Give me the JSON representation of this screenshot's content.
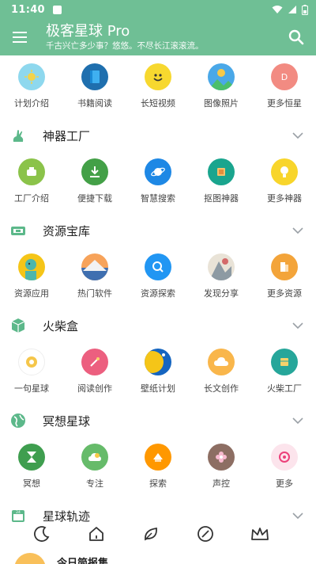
{
  "status": {
    "time": "11:40"
  },
  "header": {
    "title": "极客星球 Pro",
    "subtitle": "千古兴亡多少事？悠悠。不尽长江滚滚流。",
    "menu_icon": "hamburger-menu-icon",
    "search_icon": "search-icon"
  },
  "theme": {
    "primary": "#6fbf95"
  },
  "top_items": [
    {
      "label": "计划介绍",
      "icon": "sun-icon"
    },
    {
      "label": "书籍阅读",
      "icon": "book-icon"
    },
    {
      "label": "长短视频",
      "icon": "smiley-icon"
    },
    {
      "label": "图像照片",
      "icon": "picture-icon"
    },
    {
      "label": "更多恒星",
      "icon": "more-stars-icon"
    }
  ],
  "sections": [
    {
      "title": "神器工厂",
      "icon": "rabbit-icon",
      "items": [
        {
          "label": "工厂介绍",
          "icon": "factory-intro-icon"
        },
        {
          "label": "便捷下载",
          "icon": "download-icon"
        },
        {
          "label": "智慧搜索",
          "icon": "planet-icon"
        },
        {
          "label": "抠图神器",
          "icon": "cutout-icon"
        },
        {
          "label": "更多神器",
          "icon": "lightbulb-icon"
        }
      ]
    },
    {
      "title": "资源宝库",
      "icon": "treasure-icon",
      "items": [
        {
          "label": "资源应用",
          "icon": "app-avatar-icon"
        },
        {
          "label": "热门软件",
          "icon": "mountain-icon"
        },
        {
          "label": "资源探索",
          "icon": "explore-icon"
        },
        {
          "label": "发现分享",
          "icon": "share-illustration-icon"
        },
        {
          "label": "更多资源",
          "icon": "more-resources-icon"
        }
      ]
    },
    {
      "title": "火柴盒",
      "icon": "box-icon",
      "items": [
        {
          "label": "一句星球",
          "icon": "sentence-icon"
        },
        {
          "label": "阅读创作",
          "icon": "reading-icon"
        },
        {
          "label": "壁纸计划",
          "icon": "wallpaper-icon"
        },
        {
          "label": "长文创作",
          "icon": "cloud-icon"
        },
        {
          "label": "火柴工厂",
          "icon": "match-factory-icon"
        }
      ]
    },
    {
      "title": "冥想星球",
      "icon": "globe-icon",
      "items": [
        {
          "label": "冥想",
          "icon": "hourglass-icon"
        },
        {
          "label": "专注",
          "icon": "focus-icon"
        },
        {
          "label": "探索",
          "icon": "explore-orange-icon"
        },
        {
          "label": "声控",
          "icon": "flower-icon"
        },
        {
          "label": "更多",
          "icon": "more-pink-icon"
        }
      ]
    },
    {
      "title": "星球轨迹",
      "icon": "calendar-icon",
      "items": [
        {
          "label": "今日简报集",
          "icon": "briefing-icon"
        }
      ]
    }
  ],
  "bottom_nav": [
    {
      "name": "moon-icon"
    },
    {
      "name": "home-icon"
    },
    {
      "name": "leaf-icon"
    },
    {
      "name": "compass-icon"
    },
    {
      "name": "crown-icon"
    }
  ]
}
